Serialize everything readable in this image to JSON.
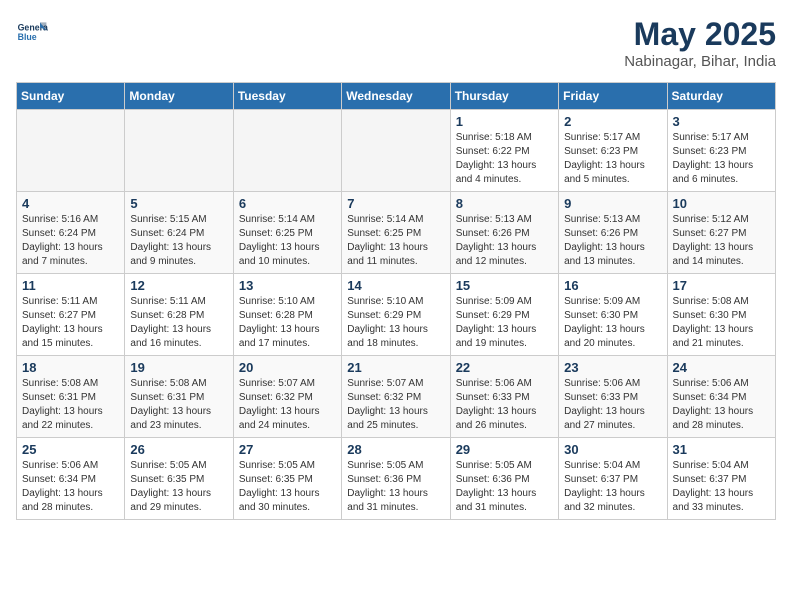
{
  "header": {
    "logo_general": "General",
    "logo_blue": "Blue",
    "month": "May 2025",
    "location": "Nabinagar, Bihar, India"
  },
  "weekdays": [
    "Sunday",
    "Monday",
    "Tuesday",
    "Wednesday",
    "Thursday",
    "Friday",
    "Saturday"
  ],
  "weeks": [
    [
      {
        "day": "",
        "empty": true
      },
      {
        "day": "",
        "empty": true
      },
      {
        "day": "",
        "empty": true
      },
      {
        "day": "",
        "empty": true
      },
      {
        "day": "1",
        "sunrise": "5:18 AM",
        "sunset": "6:22 PM",
        "daylight": "13 hours and 4 minutes."
      },
      {
        "day": "2",
        "sunrise": "5:17 AM",
        "sunset": "6:23 PM",
        "daylight": "13 hours and 5 minutes."
      },
      {
        "day": "3",
        "sunrise": "5:17 AM",
        "sunset": "6:23 PM",
        "daylight": "13 hours and 6 minutes."
      }
    ],
    [
      {
        "day": "4",
        "sunrise": "5:16 AM",
        "sunset": "6:24 PM",
        "daylight": "13 hours and 7 minutes."
      },
      {
        "day": "5",
        "sunrise": "5:15 AM",
        "sunset": "6:24 PM",
        "daylight": "13 hours and 9 minutes."
      },
      {
        "day": "6",
        "sunrise": "5:14 AM",
        "sunset": "6:25 PM",
        "daylight": "13 hours and 10 minutes."
      },
      {
        "day": "7",
        "sunrise": "5:14 AM",
        "sunset": "6:25 PM",
        "daylight": "13 hours and 11 minutes."
      },
      {
        "day": "8",
        "sunrise": "5:13 AM",
        "sunset": "6:26 PM",
        "daylight": "13 hours and 12 minutes."
      },
      {
        "day": "9",
        "sunrise": "5:13 AM",
        "sunset": "6:26 PM",
        "daylight": "13 hours and 13 minutes."
      },
      {
        "day": "10",
        "sunrise": "5:12 AM",
        "sunset": "6:27 PM",
        "daylight": "13 hours and 14 minutes."
      }
    ],
    [
      {
        "day": "11",
        "sunrise": "5:11 AM",
        "sunset": "6:27 PM",
        "daylight": "13 hours and 15 minutes."
      },
      {
        "day": "12",
        "sunrise": "5:11 AM",
        "sunset": "6:28 PM",
        "daylight": "13 hours and 16 minutes."
      },
      {
        "day": "13",
        "sunrise": "5:10 AM",
        "sunset": "6:28 PM",
        "daylight": "13 hours and 17 minutes."
      },
      {
        "day": "14",
        "sunrise": "5:10 AM",
        "sunset": "6:29 PM",
        "daylight": "13 hours and 18 minutes."
      },
      {
        "day": "15",
        "sunrise": "5:09 AM",
        "sunset": "6:29 PM",
        "daylight": "13 hours and 19 minutes."
      },
      {
        "day": "16",
        "sunrise": "5:09 AM",
        "sunset": "6:30 PM",
        "daylight": "13 hours and 20 minutes."
      },
      {
        "day": "17",
        "sunrise": "5:08 AM",
        "sunset": "6:30 PM",
        "daylight": "13 hours and 21 minutes."
      }
    ],
    [
      {
        "day": "18",
        "sunrise": "5:08 AM",
        "sunset": "6:31 PM",
        "daylight": "13 hours and 22 minutes."
      },
      {
        "day": "19",
        "sunrise": "5:08 AM",
        "sunset": "6:31 PM",
        "daylight": "13 hours and 23 minutes."
      },
      {
        "day": "20",
        "sunrise": "5:07 AM",
        "sunset": "6:32 PM",
        "daylight": "13 hours and 24 minutes."
      },
      {
        "day": "21",
        "sunrise": "5:07 AM",
        "sunset": "6:32 PM",
        "daylight": "13 hours and 25 minutes."
      },
      {
        "day": "22",
        "sunrise": "5:06 AM",
        "sunset": "6:33 PM",
        "daylight": "13 hours and 26 minutes."
      },
      {
        "day": "23",
        "sunrise": "5:06 AM",
        "sunset": "6:33 PM",
        "daylight": "13 hours and 27 minutes."
      },
      {
        "day": "24",
        "sunrise": "5:06 AM",
        "sunset": "6:34 PM",
        "daylight": "13 hours and 28 minutes."
      }
    ],
    [
      {
        "day": "25",
        "sunrise": "5:06 AM",
        "sunset": "6:34 PM",
        "daylight": "13 hours and 28 minutes."
      },
      {
        "day": "26",
        "sunrise": "5:05 AM",
        "sunset": "6:35 PM",
        "daylight": "13 hours and 29 minutes."
      },
      {
        "day": "27",
        "sunrise": "5:05 AM",
        "sunset": "6:35 PM",
        "daylight": "13 hours and 30 minutes."
      },
      {
        "day": "28",
        "sunrise": "5:05 AM",
        "sunset": "6:36 PM",
        "daylight": "13 hours and 31 minutes."
      },
      {
        "day": "29",
        "sunrise": "5:05 AM",
        "sunset": "6:36 PM",
        "daylight": "13 hours and 31 minutes."
      },
      {
        "day": "30",
        "sunrise": "5:04 AM",
        "sunset": "6:37 PM",
        "daylight": "13 hours and 32 minutes."
      },
      {
        "day": "31",
        "sunrise": "5:04 AM",
        "sunset": "6:37 PM",
        "daylight": "13 hours and 33 minutes."
      }
    ]
  ]
}
